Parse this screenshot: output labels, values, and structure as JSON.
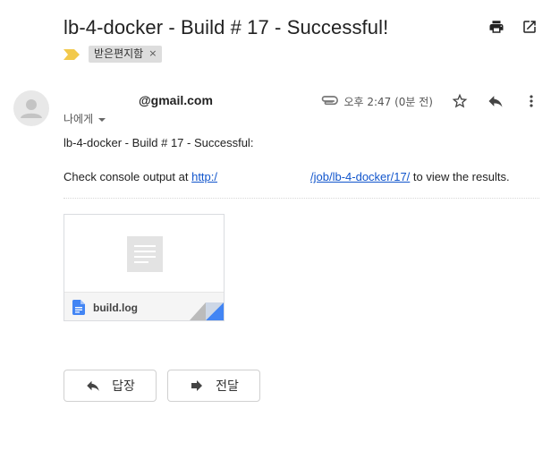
{
  "email": {
    "subject": "lb-4-docker - Build # 17 - Successful!",
    "label": "받은편지함",
    "label_remove": "×",
    "sender": "@gmail.com",
    "recipient": "나에게",
    "time": "오후 2:47 (0분 전)",
    "body_line1": "lb-4-docker - Build # 17 - Successful:",
    "body_prefix": "Check console output at ",
    "body_link_start": "http:/",
    "body_link_end": "/job/lb-4-docker/17/",
    "body_suffix": " to view the results."
  },
  "attachment": {
    "filename": "build.log"
  },
  "actions": {
    "reply": "답장",
    "forward": "전달"
  },
  "icons": {
    "print": "print-icon",
    "open_new_window": "open-in-new-window-icon",
    "importance": "importance-marker-icon",
    "attachment_clip": "paperclip-icon",
    "star": "star-icon",
    "reply": "reply-icon",
    "more": "more-vertical-icon",
    "forward": "forward-icon",
    "file": "google-docs-file-icon"
  },
  "colors": {
    "link": "#1155cc",
    "importance": "#f2c94c",
    "file_icon": "#4285f4",
    "icon": "#5f6368"
  }
}
